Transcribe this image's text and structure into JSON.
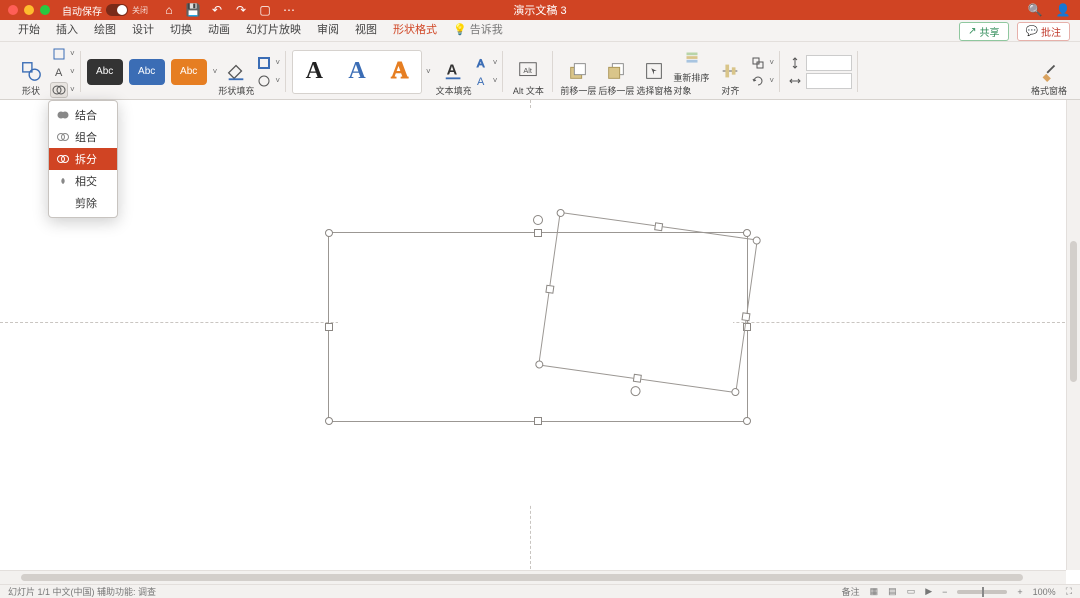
{
  "titlebar": {
    "autosave_label": "自动保存",
    "autosave_state": "关闭",
    "doc_title": "演示文稿 3"
  },
  "tabs": {
    "items": [
      "开始",
      "插入",
      "绘图",
      "设计",
      "切换",
      "动画",
      "幻灯片放映",
      "审阅",
      "视图",
      "形状格式"
    ],
    "active_index": 9,
    "tell_me": "告诉我",
    "share": "共享",
    "comments": "批注"
  },
  "ribbon": {
    "shape_btn": "形状",
    "shape_fill": "形状填充",
    "style_label": "Abc",
    "text_fill": "文本填充",
    "alt_text": "Alt 文本",
    "bring_forward": "前移一层",
    "send_backward": "后移一层",
    "selection_pane": "选择窗格",
    "reorder": "重新排序对象",
    "align": "对齐",
    "format_pane": "格式窗格"
  },
  "dropdown": {
    "items": [
      "结合",
      "组合",
      "拆分",
      "相交",
      "剪除"
    ],
    "selected_index": 2
  },
  "status": {
    "left": "幻灯片 1/1    中文(中国)    辅助功能: 调查",
    "notes": "备注",
    "zoom": "100%"
  },
  "colors": {
    "accent": "#d04423",
    "blue": "#3060a8",
    "darkblue": "#2c3e56",
    "orange": "#e0792b"
  },
  "chart_data": null
}
